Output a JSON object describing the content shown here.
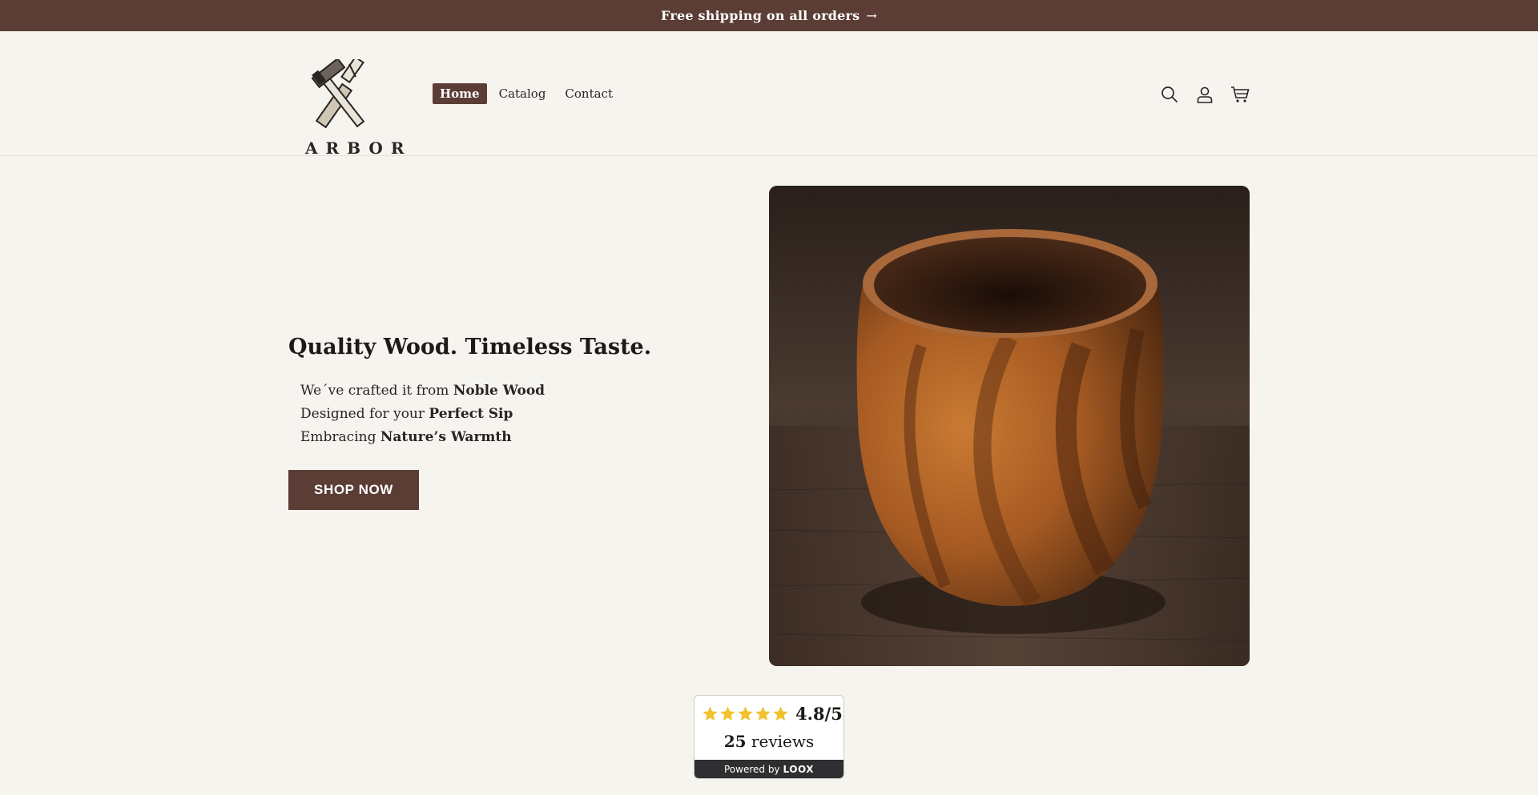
{
  "announcement": {
    "text": "Free shipping on all orders",
    "arrow": "→"
  },
  "header": {
    "logo_text": "ARBOR",
    "nav": [
      {
        "label": "Home",
        "active": true
      },
      {
        "label": "Catalog",
        "active": false
      },
      {
        "label": "Contact",
        "active": false
      }
    ],
    "icons": [
      "search-icon",
      "account-icon",
      "cart-icon"
    ]
  },
  "hero": {
    "title": "Quality Wood. Timeless Taste.",
    "lines": [
      {
        "prefix": "We´ve crafted it from ",
        "bold": "Noble Wood"
      },
      {
        "prefix": "Designed for your ",
        "bold": "Perfect Sip"
      },
      {
        "prefix": "Embracing ",
        "bold": "Nature’s Warmth"
      }
    ],
    "cta": "SHOP NOW",
    "image": "wooden-cup-photo"
  },
  "reviews": {
    "rating": "4.8/5",
    "stars": 5,
    "count": "25",
    "count_label": " reviews",
    "powered_by": "Powered by",
    "brand": "LOOX"
  },
  "colors": {
    "brand": "#5b3d35",
    "background": "#f6f4ef",
    "star": "#f2c12e"
  }
}
